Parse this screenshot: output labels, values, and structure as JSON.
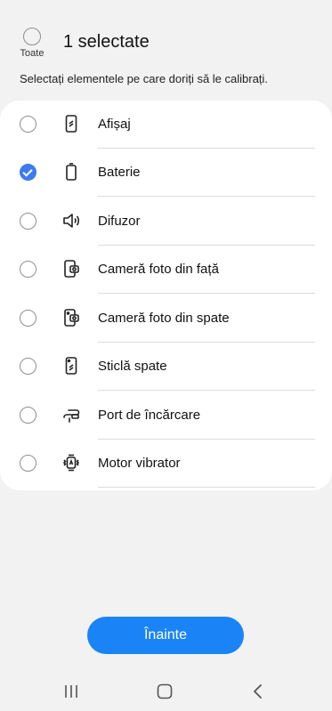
{
  "header": {
    "select_all_label": "Toate",
    "selected_count": "1 selectate"
  },
  "subtitle": "Selectați elementele pe care doriți să le calibrați.",
  "items": [
    {
      "label": "Afișaj",
      "icon": "display-icon",
      "checked": false
    },
    {
      "label": "Baterie",
      "icon": "battery-icon",
      "checked": true
    },
    {
      "label": "Difuzor",
      "icon": "speaker-icon",
      "checked": false
    },
    {
      "label": "Cameră foto din față",
      "icon": "front-camera-icon",
      "checked": false
    },
    {
      "label": "Cameră foto din spate",
      "icon": "rear-camera-icon",
      "checked": false
    },
    {
      "label": "Sticlă spate",
      "icon": "back-glass-icon",
      "checked": false
    },
    {
      "label": "Port de încărcare",
      "icon": "charging-port-icon",
      "checked": false
    },
    {
      "label": "Motor vibrator",
      "icon": "vibration-motor-icon",
      "checked": false
    }
  ],
  "next_button": "Înainte",
  "navbar": {
    "recents": "recents-icon",
    "home": "home-icon",
    "back": "back-icon"
  },
  "colors": {
    "accent": "#3e7bf0",
    "button": "#1a84f7",
    "background": "#f2f2f3",
    "card": "#ffffff"
  }
}
